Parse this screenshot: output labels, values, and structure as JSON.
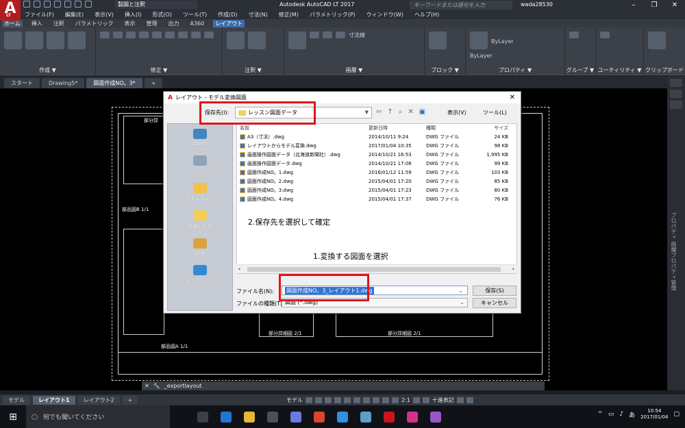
{
  "app": {
    "title": "Autodesk AutoCAD LT 2017",
    "logo": "A",
    "logo_sub": "LT",
    "workspace": "製図と注釈",
    "search_placeholder": "キーワードまたは語句を入力",
    "user": "wada28530"
  },
  "menu": [
    "ファイル(F)",
    "編集(E)",
    "表示(V)",
    "挿入(I)",
    "形式(O)",
    "ツール(T)",
    "作成(D)",
    "寸法(N)",
    "修正(M)",
    "パラメトリック(P)",
    "ウィンドウ(W)",
    "ヘルプ(H)"
  ],
  "ribbon_tabs": [
    "ホーム",
    "挿入",
    "注釈",
    "パラメトリック",
    "表示",
    "管理",
    "出力",
    "A360",
    "レイアウト"
  ],
  "ribbon_panels": [
    "作成 ▼",
    "修正 ▼",
    "注釈 ▼",
    "画層 ▼",
    "ブロック ▼",
    "プロパティ ▼",
    "グループ ▼",
    "ユーティリティ ▼",
    "クリップボード"
  ],
  "ribbon_layer": {
    "bylayer1": "ByLayer",
    "bylayer2": "ByLayer",
    "layer_name": "寸法線"
  },
  "doc_tabs": [
    "スタート",
    "Drawing5*",
    "図面作成NO。3*"
  ],
  "drawing_labels": {
    "a": "部分詳",
    "b": "部品図B 1/1",
    "c": "部品図A 1/1",
    "d": "部分詳細図 2/1",
    "e": "部分詳細図 2/1"
  },
  "right_strip_label": "プロパティ 画層プロパティ管理",
  "command": {
    "text": "_exportlayout"
  },
  "layout_tabs": [
    "モデル",
    "レイアウト1",
    "レイアウト2",
    "+"
  ],
  "status": {
    "model": "モデル",
    "scale": "2:1",
    "units": "十進表記"
  },
  "taskbar": {
    "search_placeholder": "何でも聞いてください",
    "ime": "あ",
    "time": "10:54",
    "date": "2017/01/04"
  },
  "dialog": {
    "title": "レイアウト - モデル変換図面",
    "save_in_label": "保存先(I):",
    "save_in_value": "レッスン図面データ",
    "view_menu": "表示(V)",
    "tools_menu": "ツール(L)",
    "places": [
      "A360",
      "ヒストリ",
      "ドキュメント",
      "お気に入り",
      "FTP",
      "デスクトップ"
    ],
    "columns": [
      "名前",
      "更新日時",
      "種類",
      "サイズ"
    ],
    "files": [
      {
        "name": "A3（寸法）.dwg",
        "date": "2014/10/11 9:24",
        "type": "DWG ファイル",
        "size": "24 KB"
      },
      {
        "name": "レイアウトからモデル変換.dwg",
        "date": "2017/01/04 10:35",
        "type": "DWG ファイル",
        "size": "98 KB"
      },
      {
        "name": "画面操作図面データ（北海道新聞社）.dwg",
        "date": "2014/10/21 16:53",
        "type": "DWG ファイル",
        "size": "1,995 KB"
      },
      {
        "name": "画面操作図面データ.dwg",
        "date": "2014/10/21 17:08",
        "type": "DWG ファイル",
        "size": "99 KB"
      },
      {
        "name": "図面作成NO。1.dwg",
        "date": "2016/01/12 11:59",
        "type": "DWG ファイル",
        "size": "103 KB"
      },
      {
        "name": "図面作成NO。2.dwg",
        "date": "2015/04/01 17:20",
        "type": "DWG ファイル",
        "size": "85 KB"
      },
      {
        "name": "図面作成NO。3.dwg",
        "date": "2015/04/01 17:23",
        "type": "DWG ファイル",
        "size": "80 KB"
      },
      {
        "name": "図面作成NO。4.dwg",
        "date": "2015/04/01 17:37",
        "type": "DWG ファイル",
        "size": "76 KB"
      }
    ],
    "annotation_2": "2.保存先を選択して確定",
    "annotation_1": "1.変換する図面を選択",
    "filename_label": "ファイル名(N):",
    "filename_value": "図面作成NO。3_レイアウト1.dwg",
    "filetype_label": "ファイルの種類(T):",
    "filetype_value": "図面 (*.dwg)",
    "save_button": "保存(S)",
    "cancel_button": "キャンセル"
  },
  "colors": {
    "highlight": "#e0141a",
    "accent": "#3374d0",
    "brand": "#b31c1c"
  }
}
